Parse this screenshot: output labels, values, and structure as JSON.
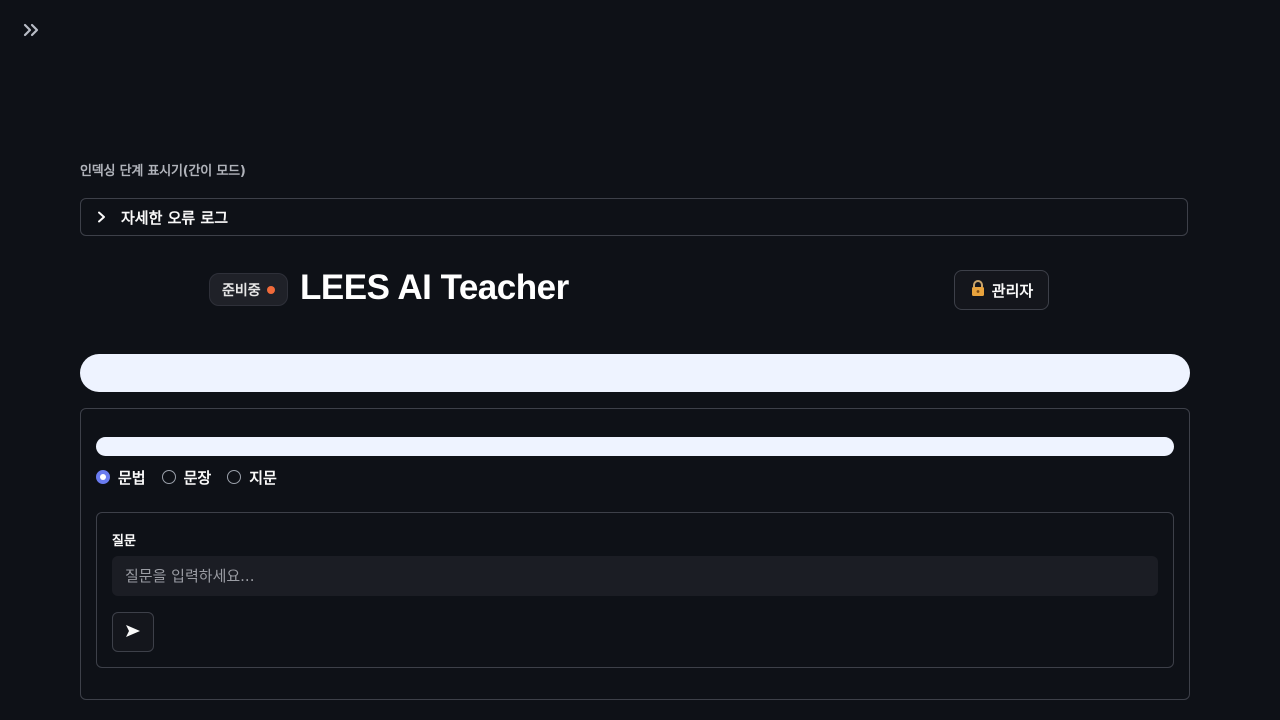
{
  "header": {
    "index_label": "인덱싱 단계 표시기(간이 모드)"
  },
  "expander": {
    "title": "자세한 오류 로그",
    "expanded": false
  },
  "title_row": {
    "status_badge": "준비중",
    "status_dot_color": "#f06a3a",
    "app_title": "LEES AI Teacher",
    "admin_button_label": "관리자",
    "admin_icon": "lock-icon"
  },
  "mode": {
    "options": [
      "문법",
      "문장",
      "지문"
    ],
    "selected": "문법"
  },
  "question": {
    "label": "질문",
    "value": "",
    "placeholder": "질문을 입력하세요..."
  },
  "send_button": {
    "icon": "send-icon",
    "glyph": "➤"
  },
  "colors": {
    "background": "#0e1117",
    "accent": "#6a7cf0",
    "bar_fill": "#eef3ff"
  }
}
